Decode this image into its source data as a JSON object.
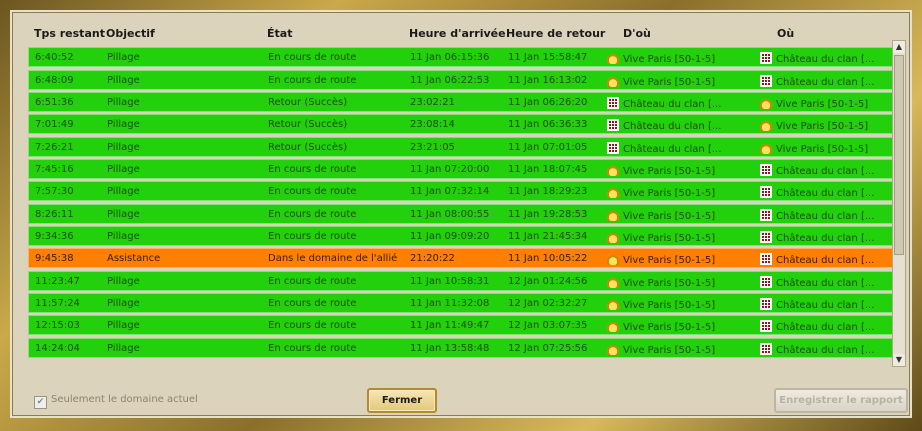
{
  "headers": [
    "Tps restant",
    "Objectif",
    "État",
    "Heure d'arrivée",
    "Heure de retour",
    "D'où",
    "Où"
  ],
  "rows": [
    {
      "tps": "6:40:52",
      "objectif": "Pillage",
      "etat": "En cours de route",
      "arrivee": "11 Jan 06:15:36",
      "retour": "11 Jan 15:58:47",
      "dou": "Vive Paris [50-1-5]",
      "dou_icon": "crown",
      "ou": "Château du clan [...",
      "ou_icon": "castle",
      "color": "green"
    },
    {
      "tps": "6:48:09",
      "objectif": "Pillage",
      "etat": "En cours de route",
      "arrivee": "11 Jan 06:22:53",
      "retour": "11 Jan 16:13:02",
      "dou": "Vive Paris [50-1-5]",
      "dou_icon": "crown",
      "ou": "Château du clan [...",
      "ou_icon": "castle",
      "color": "green"
    },
    {
      "tps": "6:51:36",
      "objectif": "Pillage",
      "etat": "Retour (Succès)",
      "arrivee": "23:02:21",
      "retour": "11 Jan 06:26:20",
      "dou": "Château du clan [...",
      "dou_icon": "castle",
      "ou": "Vive Paris [50-1-5]",
      "ou_icon": "crown",
      "color": "green"
    },
    {
      "tps": "7:01:49",
      "objectif": "Pillage",
      "etat": "Retour (Succès)",
      "arrivee": "23:08:14",
      "retour": "11 Jan 06:36:33",
      "dou": "Château du clan [...",
      "dou_icon": "castle",
      "ou": "Vive Paris [50-1-5]",
      "ou_icon": "crown",
      "color": "green"
    },
    {
      "tps": "7:26:21",
      "objectif": "Pillage",
      "etat": "Retour (Succès)",
      "arrivee": "23:21:05",
      "retour": "11 Jan 07:01:05",
      "dou": "Château du clan [...",
      "dou_icon": "castle",
      "ou": "Vive Paris [50-1-5]",
      "ou_icon": "crown",
      "color": "green"
    },
    {
      "tps": "7:45:16",
      "objectif": "Pillage",
      "etat": "En cours de route",
      "arrivee": "11 Jan 07:20:00",
      "retour": "11 Jan 18:07:45",
      "dou": "Vive Paris [50-1-5]",
      "dou_icon": "crown",
      "ou": "Château du clan [...",
      "ou_icon": "castle",
      "color": "green"
    },
    {
      "tps": "7:57:30",
      "objectif": "Pillage",
      "etat": "En cours de route",
      "arrivee": "11 Jan 07:32:14",
      "retour": "11 Jan 18:29:23",
      "dou": "Vive Paris [50-1-5]",
      "dou_icon": "crown",
      "ou": "Château du clan [...",
      "ou_icon": "castle",
      "color": "green"
    },
    {
      "tps": "8:26:11",
      "objectif": "Pillage",
      "etat": "En cours de route",
      "arrivee": "11 Jan 08:00:55",
      "retour": "11 Jan 19:28:53",
      "dou": "Vive Paris [50-1-5]",
      "dou_icon": "crown",
      "ou": "Château du clan [...",
      "ou_icon": "castle",
      "color": "green"
    },
    {
      "tps": "9:34:36",
      "objectif": "Pillage",
      "etat": "En cours de route",
      "arrivee": "11 Jan 09:09:20",
      "retour": "11 Jan 21:45:34",
      "dou": "Vive Paris [50-1-5]",
      "dou_icon": "crown",
      "ou": "Château du clan [...",
      "ou_icon": "castle",
      "color": "green"
    },
    {
      "tps": "9:45:38",
      "objectif": "Assistance",
      "etat": "Dans le domaine de l'allié",
      "arrivee": "21:20:22",
      "retour": "11 Jan 10:05:22",
      "dou": "Vive Paris [50-1-5]",
      "dou_icon": "crown",
      "ou": "Château du clan [...",
      "ou_icon": "castle",
      "color": "orange"
    },
    {
      "tps": "11:23:47",
      "objectif": "Pillage",
      "etat": "En cours de route",
      "arrivee": "11 Jan 10:58:31",
      "retour": "12 Jan 01:24:56",
      "dou": "Vive Paris [50-1-5]",
      "dou_icon": "crown",
      "ou": "Château du clan [...",
      "ou_icon": "castle",
      "color": "green"
    },
    {
      "tps": "11:57:24",
      "objectif": "Pillage",
      "etat": "En cours de route",
      "arrivee": "11 Jan 11:32:08",
      "retour": "12 Jan 02:32:27",
      "dou": "Vive Paris [50-1-5]",
      "dou_icon": "crown",
      "ou": "Château du clan [...",
      "ou_icon": "castle",
      "color": "green"
    },
    {
      "tps": "12:15:03",
      "objectif": "Pillage",
      "etat": "En cours de route",
      "arrivee": "11 Jan 11:49:47",
      "retour": "12 Jan 03:07:35",
      "dou": "Vive Paris [50-1-5]",
      "dou_icon": "crown",
      "ou": "Château du clan [...",
      "ou_icon": "castle",
      "color": "green"
    },
    {
      "tps": "14:24:04",
      "objectif": "Pillage",
      "etat": "En cours de route",
      "arrivee": "11 Jan 13:58:48",
      "retour": "12 Jan 07:25:56",
      "dou": "Vive Paris [50-1-5]",
      "dou_icon": "crown",
      "ou": "Château du clan [...",
      "ou_icon": "castle",
      "color": "green"
    }
  ],
  "footer": {
    "checkbox_label": "Seulement le domaine actuel",
    "checkbox_checked": true,
    "close_label": "Fermer",
    "save_label": "Enregistrer le rapport"
  },
  "colors": {
    "row_green": "#22d10b",
    "row_orange": "#ff7f00"
  }
}
